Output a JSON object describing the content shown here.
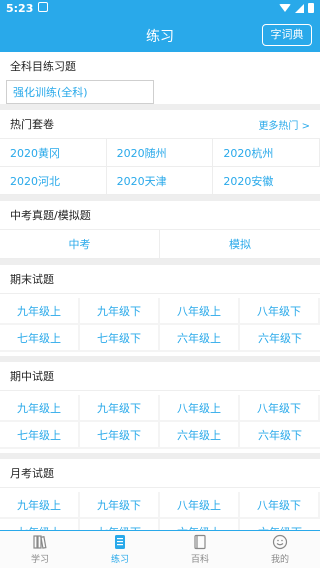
{
  "status": {
    "time": "5:23"
  },
  "appbar": {
    "title": "练习",
    "dict_button": "字词典"
  },
  "full_practice": {
    "heading": "全科目练习题",
    "button": "强化训练(全科)"
  },
  "hot": {
    "heading": "热门套卷",
    "more": "更多热门 >",
    "items": [
      "2020黄冈",
      "2020随州",
      "2020杭州",
      "2020河北",
      "2020天津",
      "2020安徽"
    ]
  },
  "zhongkao": {
    "heading": "中考真题/模拟题",
    "items": [
      "中考",
      "模拟"
    ]
  },
  "final_exams": {
    "heading": "期末试题",
    "items": [
      "九年级上",
      "九年级下",
      "八年级上",
      "八年级下",
      "七年级上",
      "七年级下",
      "六年级上",
      "六年级下"
    ]
  },
  "midterm_exams": {
    "heading": "期中试题",
    "items": [
      "九年级上",
      "九年级下",
      "八年级上",
      "八年级下",
      "七年级上",
      "七年级下",
      "六年级上",
      "六年级下"
    ]
  },
  "monthly_exams": {
    "heading": "月考试题",
    "items": [
      "九年级上",
      "九年级下",
      "八年级上",
      "八年级下",
      "七年级上",
      "七年级下",
      "六年级上",
      "六年级下"
    ]
  },
  "tabs": [
    {
      "label": "学习",
      "icon": "books-icon"
    },
    {
      "label": "练习",
      "icon": "notebook-icon"
    },
    {
      "label": "百科",
      "icon": "book-icon"
    },
    {
      "label": "我的",
      "icon": "smiley-icon"
    }
  ],
  "colors": {
    "accent": "#29a9ea"
  }
}
